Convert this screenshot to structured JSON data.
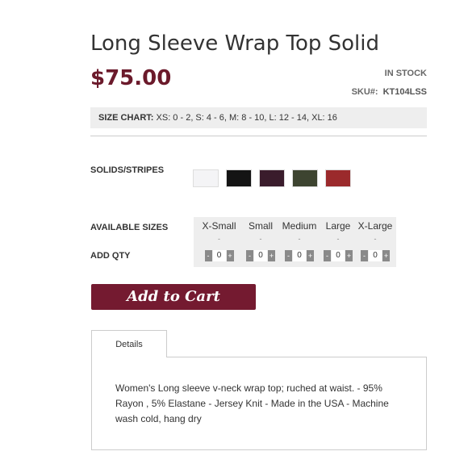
{
  "product": {
    "title": "Long Sleeve Wrap Top Solid",
    "price": "$75.00",
    "stock_status": "IN STOCK",
    "sku_label": "SKU#:",
    "sku_value": "KT104LSS"
  },
  "size_chart": {
    "label": "SIZE CHART:",
    "text": "XS: 0 - 2, S: 4 - 6, M: 8 - 10, L: 12 - 14, XL: 16"
  },
  "colors": {
    "label": "SOLIDS/STRIPES",
    "swatches": [
      {
        "name": "white",
        "hex": "#f4f4f6"
      },
      {
        "name": "black",
        "hex": "#141414"
      },
      {
        "name": "plum",
        "hex": "#3a1c2c"
      },
      {
        "name": "olive",
        "hex": "#3d4430"
      },
      {
        "name": "red",
        "hex": "#9b2a2c"
      }
    ]
  },
  "sizes": {
    "label": "AVAILABLE SIZES",
    "qty_label": "ADD QTY",
    "items": [
      {
        "name": "X-Small",
        "dash": "-",
        "qty": "0",
        "minus": "-",
        "plus": "+"
      },
      {
        "name": "Small",
        "dash": "-",
        "qty": "0",
        "minus": "-",
        "plus": "+"
      },
      {
        "name": "Medium",
        "dash": "-",
        "qty": "0",
        "minus": "-",
        "plus": "+"
      },
      {
        "name": "Large",
        "dash": "-",
        "qty": "0",
        "minus": "-",
        "plus": "+"
      },
      {
        "name": "X-Large",
        "dash": "-",
        "qty": "0",
        "minus": "-",
        "plus": "+"
      }
    ]
  },
  "cart": {
    "button_label": "Add to Cart",
    "accent_color": "#741a30"
  },
  "tabs": {
    "active_label": "Details",
    "content": "Women's Long sleeve v-neck wrap top; ruched at waist. - 95% Rayon , 5% Elastane - Jersey Knit - Made in the USA - Machine wash cold, hang dry"
  }
}
